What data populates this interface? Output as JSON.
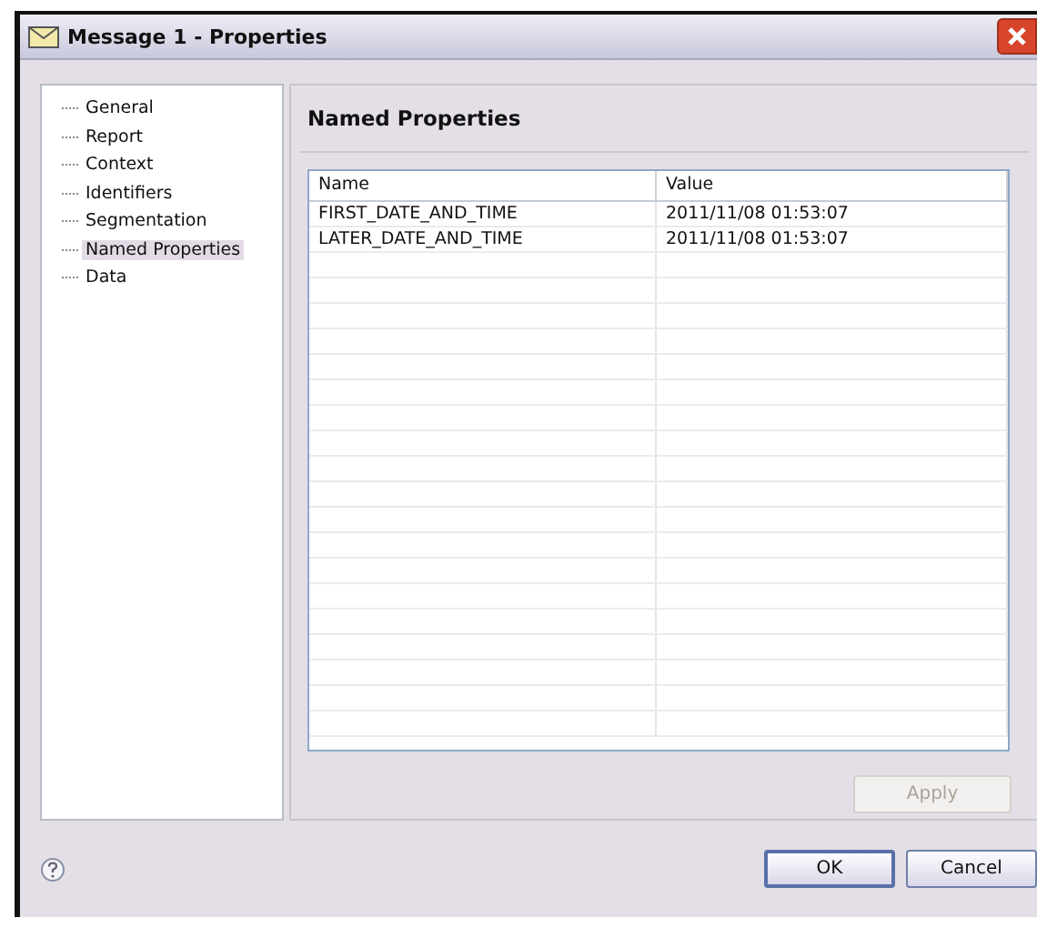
{
  "window": {
    "title": "Message 1 - Properties"
  },
  "sidebar": {
    "items": [
      {
        "label": "General",
        "selected": false
      },
      {
        "label": "Report",
        "selected": false
      },
      {
        "label": "Context",
        "selected": false
      },
      {
        "label": "Identifiers",
        "selected": false
      },
      {
        "label": "Segmentation",
        "selected": false
      },
      {
        "label": "Named Properties",
        "selected": true
      },
      {
        "label": "Data",
        "selected": false
      }
    ]
  },
  "panel": {
    "title": "Named Properties"
  },
  "table": {
    "columns": [
      "Name",
      "Value"
    ],
    "rows": [
      [
        "FIRST_DATE_AND_TIME",
        "2011/11/08 01:53:07"
      ],
      [
        "LATER_DATE_AND_TIME",
        "2011/11/08 01:53:07"
      ]
    ]
  },
  "apply_button": {
    "label": "Apply",
    "disabled": true
  },
  "buttons": [
    "OK",
    "Cancel"
  ]
}
